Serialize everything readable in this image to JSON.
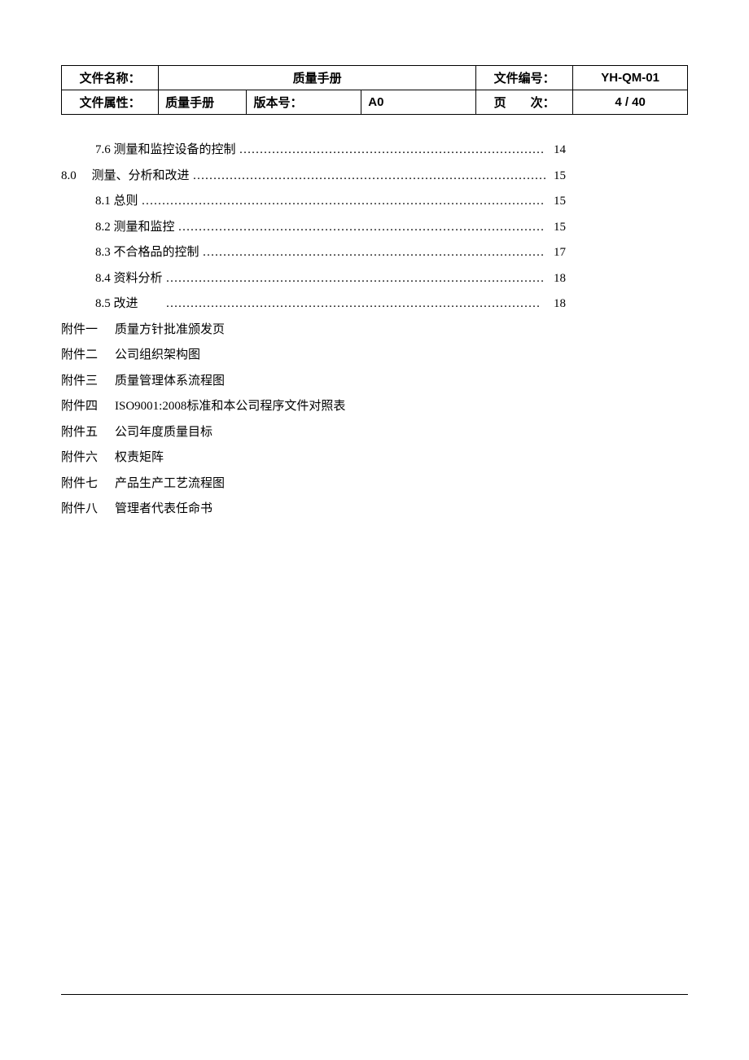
{
  "header": {
    "row1": {
      "label_name": "文件名称：",
      "doc_title": "质量手册",
      "label_number": "文件编号：",
      "doc_number": "YH-QM-01"
    },
    "row2": {
      "label_attr": "文件属性：",
      "attr_value": "质量手册",
      "label_version": "版本号：",
      "version_value": "A0",
      "label_page": "页　　次：",
      "page_value": "4 / 40"
    }
  },
  "toc": [
    {
      "indent": 1,
      "label": "7.6  测量和监控设备的控制",
      "page": "14",
      "leader": true
    },
    {
      "indent": 0,
      "label": "8.0　 测量、分析和改进",
      "page": "15",
      "leader": true
    },
    {
      "indent": 1,
      "label": "8.1  总则",
      "page": "15",
      "leader": true
    },
    {
      "indent": 1,
      "label": "8.2  测量和监控",
      "page": "15",
      "leader": true
    },
    {
      "indent": 1,
      "label": "8.3  不合格品的控制",
      "page": "17",
      "leader": true
    },
    {
      "indent": 1,
      "label": "8.4  资料分析",
      "page": "18",
      "leader": true
    },
    {
      "indent": 1,
      "label": "8.5  改进　　",
      "page": "18",
      "leader": true,
      "page_pad": true
    }
  ],
  "appendices": [
    {
      "key": "附件一",
      "val": "质量方针批准颁发页",
      "gap": "　 "
    },
    {
      "key": "附件二",
      "val": "公司组织架构图",
      "gap": "   "
    },
    {
      "key": "附件三",
      "val": "质量管理体系流程图",
      "gap": "   "
    },
    {
      "key": "附件四",
      "val": "ISO9001:2008标准和本公司程序文件对照表",
      "gap": "   "
    },
    {
      "key": "附件五",
      "val": "公司年度质量目标",
      "gap": "   "
    },
    {
      "key": "附件六",
      "val": "权责矩阵",
      "gap": "   "
    },
    {
      "key": "附件七",
      "val": "产品生产工艺流程图",
      "gap": "  "
    },
    {
      "key": "附件八",
      "val": "管理者代表任命书",
      "gap": "   "
    }
  ]
}
